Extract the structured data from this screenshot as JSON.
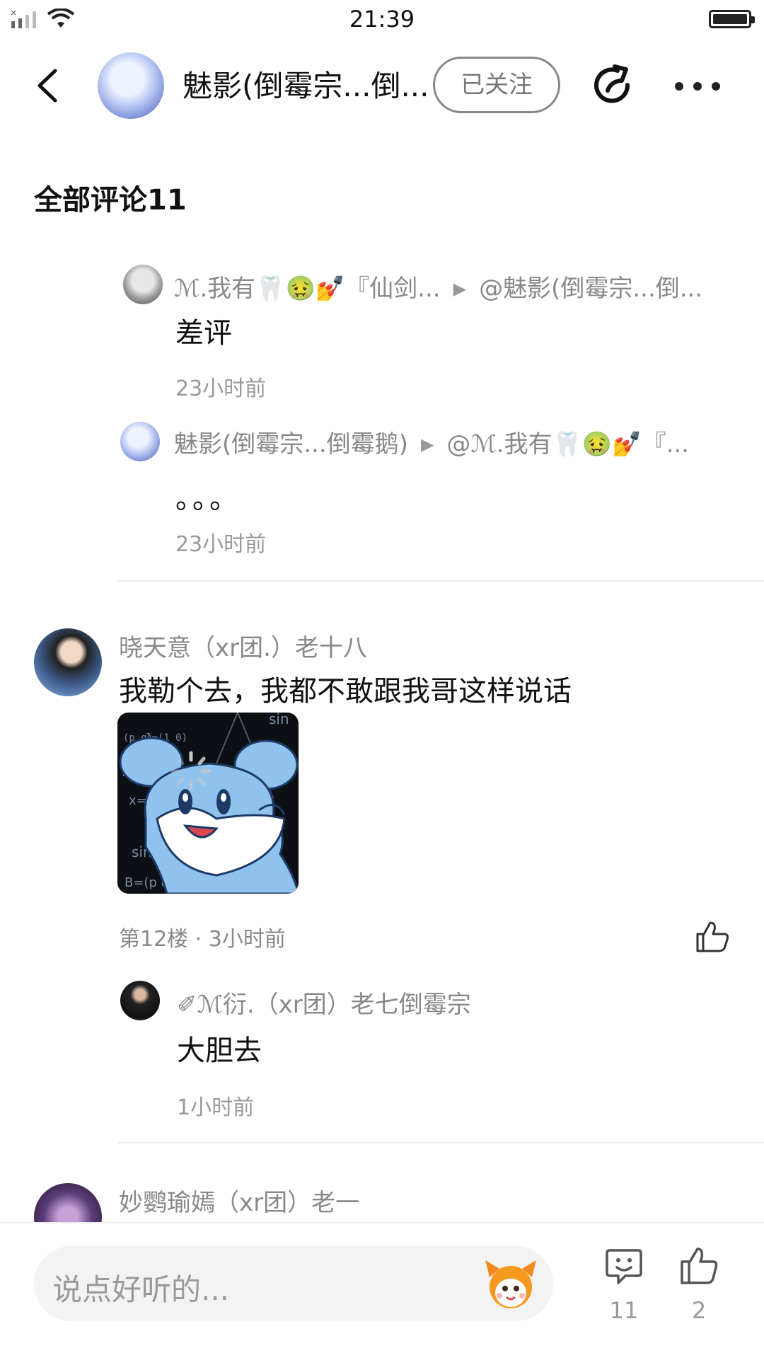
{
  "status_bar": {
    "time": "21:39"
  },
  "header": {
    "author_name": "魅影(倒霉宗...倒...",
    "follow_label": "已关注"
  },
  "section_title": "全部评论11",
  "replies_top": [
    {
      "user": "ℳ.我有🦷🤢💅『仙剑...",
      "target": "@魅影(倒霉宗...倒...",
      "text": "差评",
      "time": "23小时前"
    },
    {
      "user": "魅影(倒霉宗...倒霉鹅)",
      "target": "@ℳ.我有🦷🤢💅『...",
      "text": "。。。",
      "time": "23小时前"
    }
  ],
  "comment_1": {
    "user": "晓天意（xr团.）老十八",
    "text": "我勒个去，我都不敢跟我哥这样说话",
    "meta": "第12楼 · 3小时前",
    "image_icon": "cartoon-sticker-image",
    "reply": {
      "user": "✐ℳ衍.（xr团）老七倒霉宗",
      "text": "大胆去",
      "time": "1小时前"
    }
  },
  "comment_2": {
    "user": "妙鹦瑜嫣（xr团）老一"
  },
  "bottom_bar": {
    "input_placeholder": "说点好听的...",
    "comment_count": "11",
    "like_count": "2"
  }
}
